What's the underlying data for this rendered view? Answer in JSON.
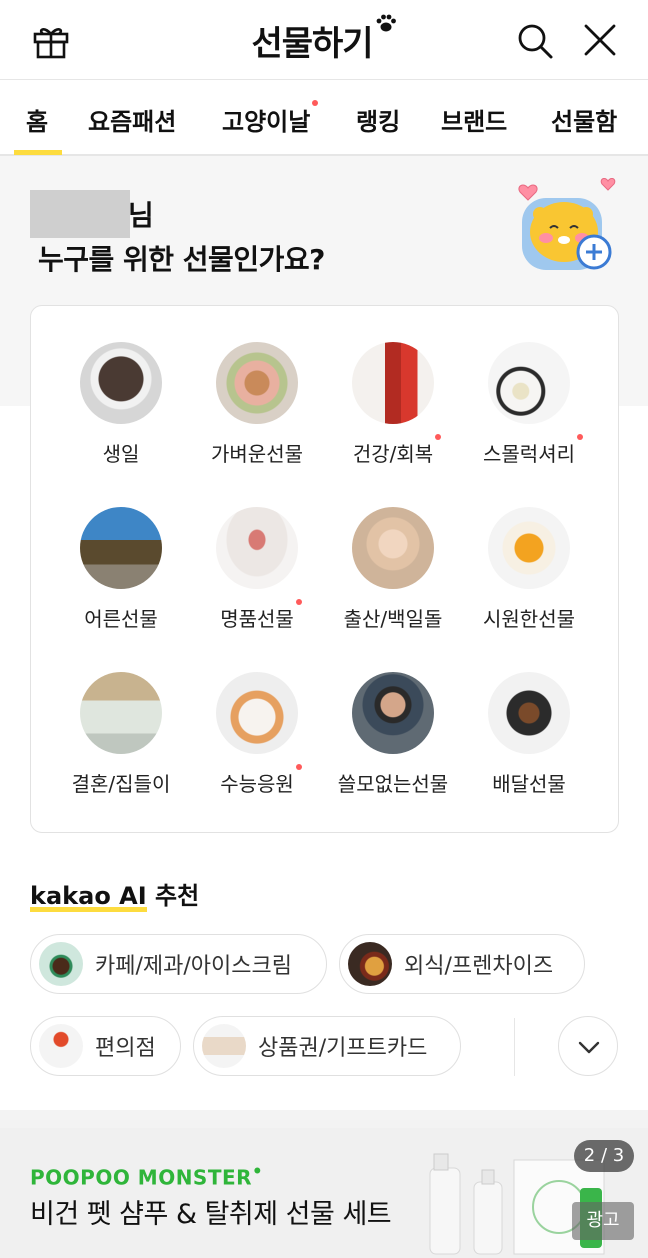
{
  "header": {
    "title": "선물하기",
    "icons": [
      "gift-icon",
      "paw-icon",
      "search-icon",
      "close-icon"
    ]
  },
  "tabs": [
    {
      "label": "홈",
      "active": true,
      "new_dot": false
    },
    {
      "label": "요즘패션",
      "active": false,
      "new_dot": false
    },
    {
      "label": "고양이날",
      "active": false,
      "new_dot": true
    },
    {
      "label": "랭킹",
      "active": false,
      "new_dot": false
    },
    {
      "label": "브랜드",
      "active": false,
      "new_dot": false
    },
    {
      "label": "선물함",
      "active": false,
      "new_dot": false
    }
  ],
  "greeting": {
    "name_suffix": "님",
    "question": "누구를 위한 선물인가요?"
  },
  "categories": [
    {
      "label": "생일",
      "new_dot": false
    },
    {
      "label": "가벼운선물",
      "new_dot": false
    },
    {
      "label": "건강/회복",
      "new_dot": true
    },
    {
      "label": "스몰럭셔리",
      "new_dot": true
    },
    {
      "label": "어른선물",
      "new_dot": false
    },
    {
      "label": "명품선물",
      "new_dot": true
    },
    {
      "label": "출산/백일돌",
      "new_dot": false
    },
    {
      "label": "시원한선물",
      "new_dot": false
    },
    {
      "label": "결혼/집들이",
      "new_dot": false
    },
    {
      "label": "수능응원",
      "new_dot": true
    },
    {
      "label": "쓸모없는선물",
      "new_dot": false
    },
    {
      "label": "배달선물",
      "new_dot": false
    }
  ],
  "ai_section": {
    "brand": "kakao AI",
    "title_suffix": " 추천",
    "chips": [
      {
        "label": "카페/제과/아이스크림",
        "icon": "coffee-cup-icon"
      },
      {
        "label": "외식/프렌차이즈",
        "icon": "food-icon"
      },
      {
        "label": "편의점",
        "icon": "lollipop-icon"
      },
      {
        "label": "상품권/기프트카드",
        "icon": "gift-card-icon"
      }
    ]
  },
  "banner": {
    "brand": "POOPOO MONSTER",
    "brand_mark": "•",
    "headline": "비건 펫 샴푸 & 탈취제 선물 세트",
    "page_current": "2",
    "page_total": "3",
    "ad_label": "광고"
  },
  "colors": {
    "accent_yellow": "#fddc3f",
    "new_dot": "#ff5a5a",
    "banner_brand": "#2fb53a"
  }
}
